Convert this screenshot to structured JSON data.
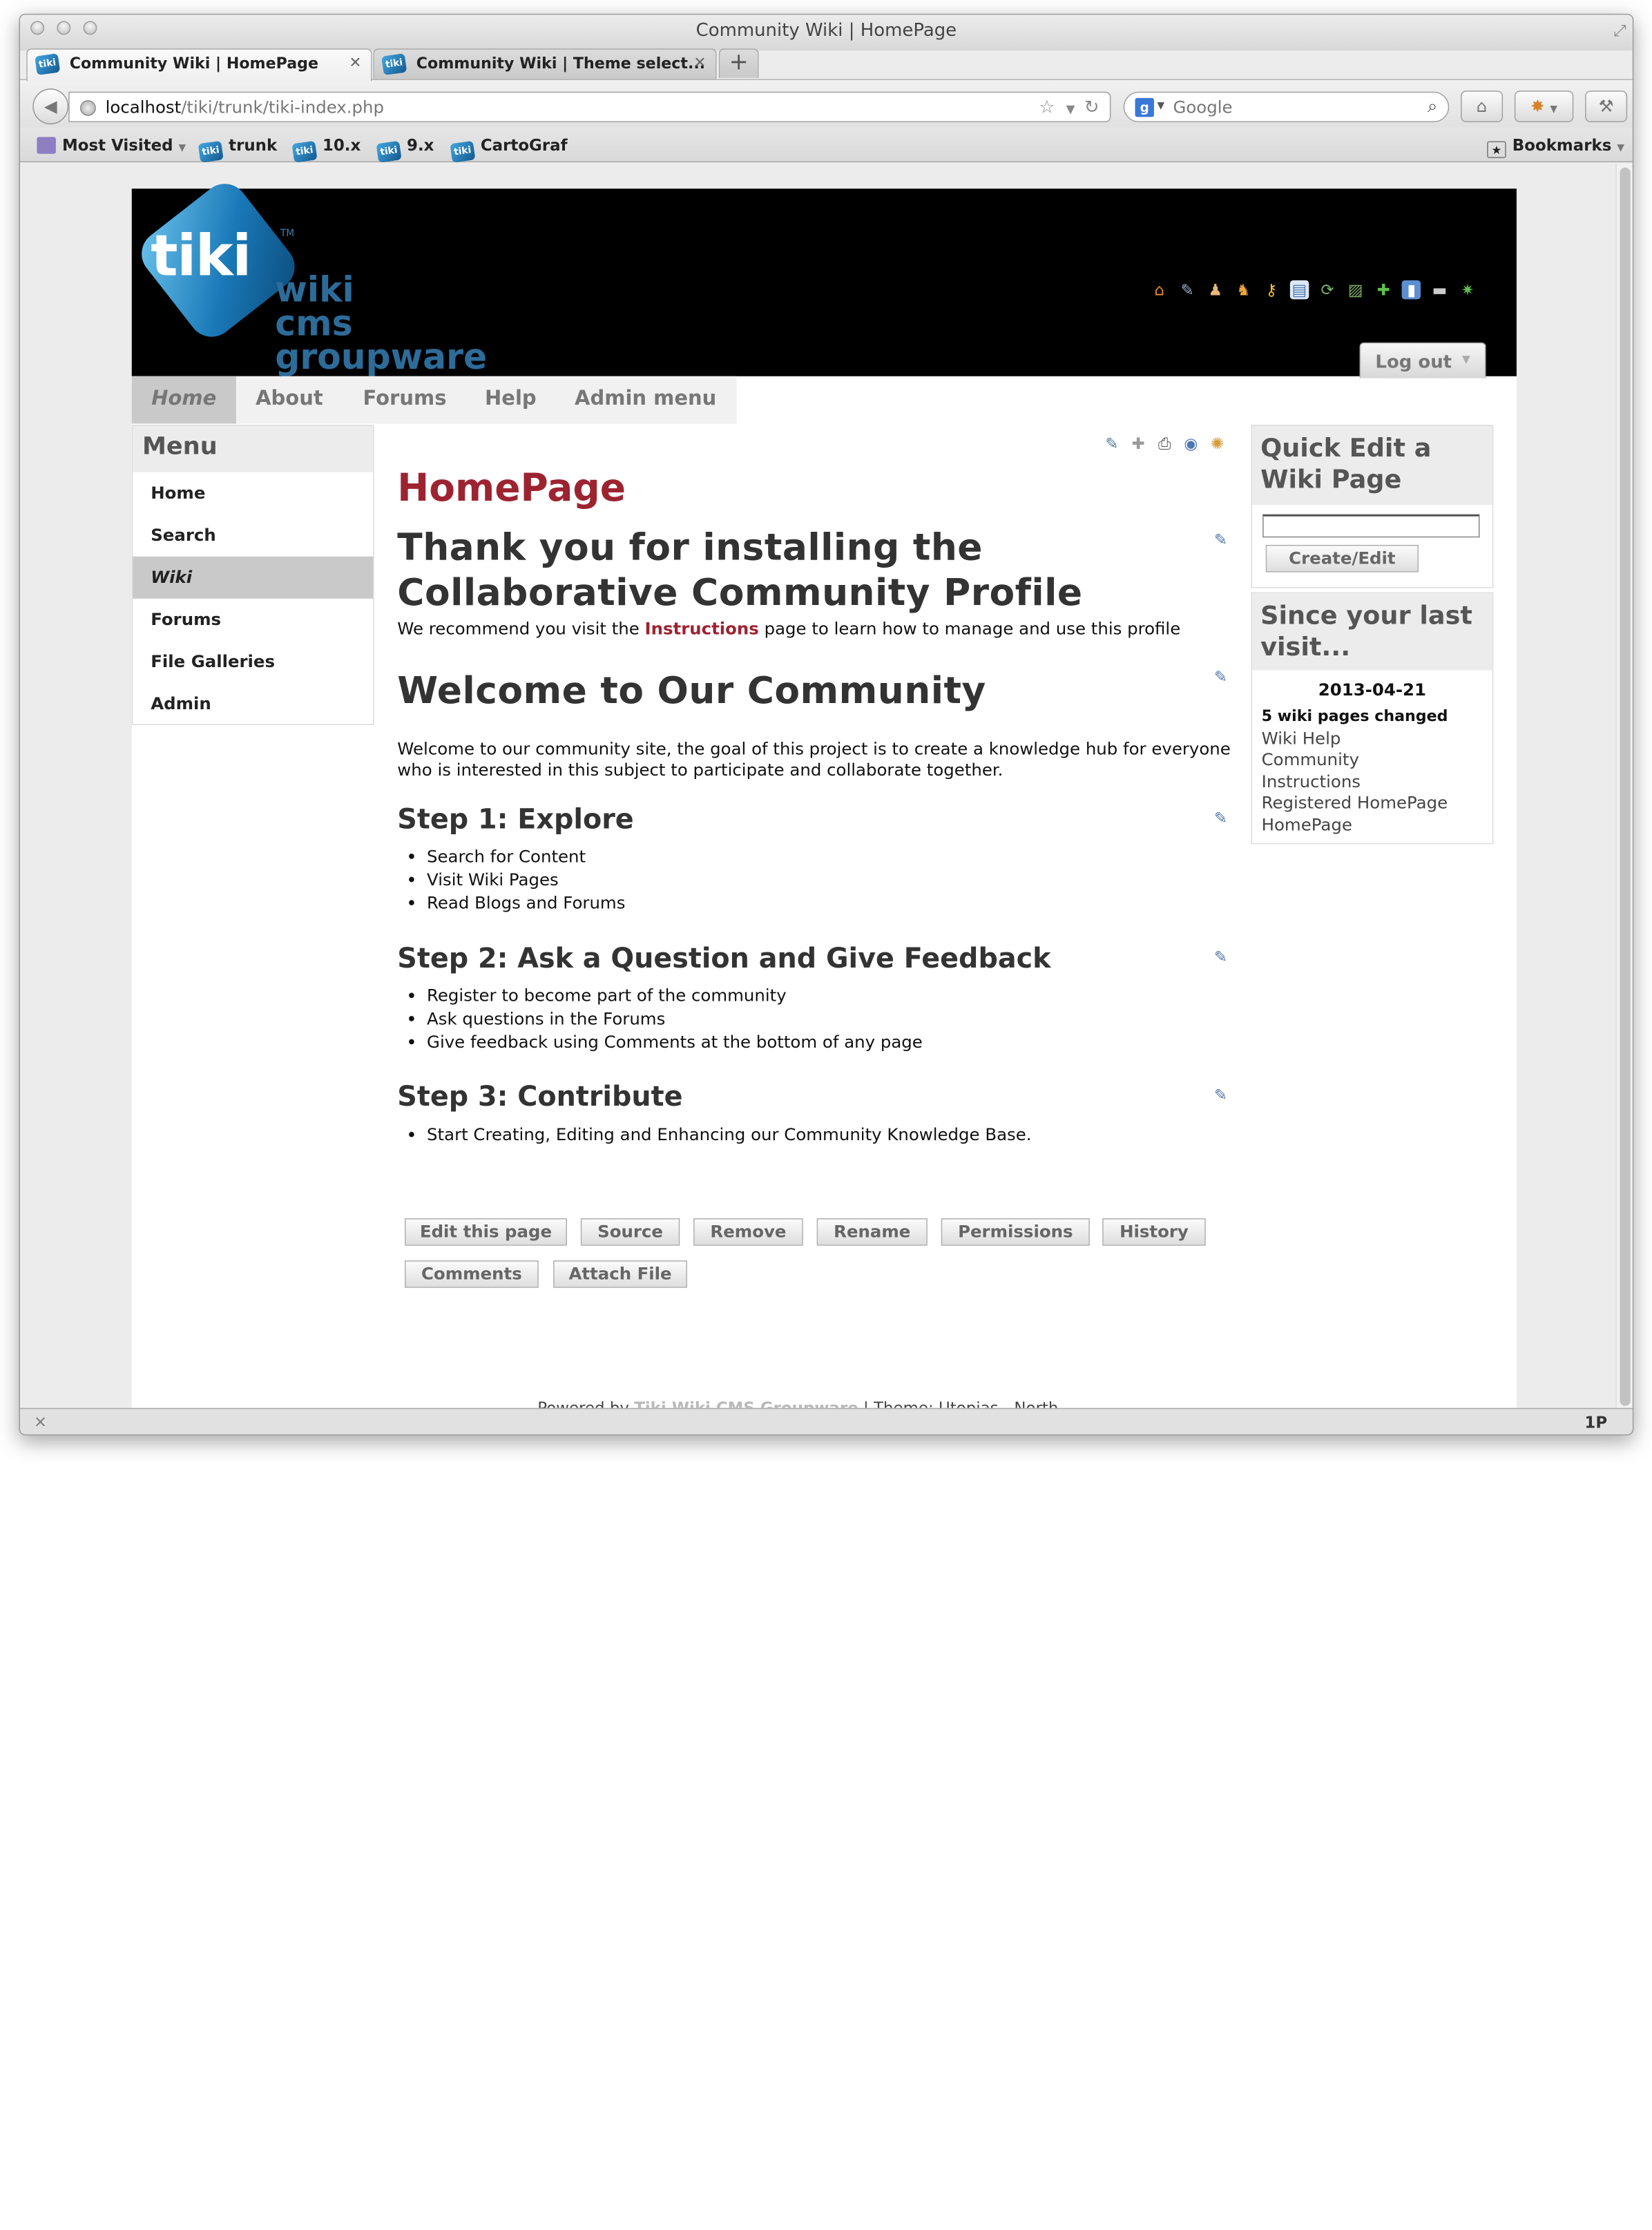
{
  "window": {
    "title": "Community Wiki | HomePage"
  },
  "tabs": [
    {
      "label": "Community Wiki | HomePage",
      "active": true
    },
    {
      "label": "Community Wiki | Theme select...",
      "active": false
    }
  ],
  "tab_favicon_text": "tiki",
  "new_tab_label": "+",
  "address": {
    "host": "localhost",
    "path": "/tiki/trunk/tiki-index.php"
  },
  "search": {
    "engine_icon": "g",
    "placeholder": "Google"
  },
  "bookmarks_bar": [
    {
      "label": "Most Visited",
      "icon": "most-visited-icon",
      "dropdown": true
    },
    {
      "label": "trunk",
      "icon": "tiki-favicon"
    },
    {
      "label": "10.x",
      "icon": "tiki-favicon"
    },
    {
      "label": "9.x",
      "icon": "tiki-favicon"
    },
    {
      "label": "CartoGraf",
      "icon": "tiki-favicon"
    }
  ],
  "bookmarks_menu": "Bookmarks",
  "site": {
    "logo": {
      "mark": "tiki",
      "trademark": "TM",
      "words": [
        "wiki",
        "cms",
        "groupware"
      ]
    },
    "logout": "Log out",
    "top_icons": [
      "home-icon",
      "wrench-icon",
      "user-icon",
      "users-icon",
      "key-icon",
      "panel-icon",
      "refresh-icon",
      "edit-page-icon",
      "plugin-icon",
      "file-icon",
      "minus-icon",
      "gear-icon"
    ],
    "nav": [
      "Home",
      "About",
      "Forums",
      "Help",
      "Admin menu"
    ],
    "nav_active": 0,
    "menu": {
      "title": "Menu",
      "items": [
        "Home",
        "Search",
        "Wiki",
        "Forums",
        "File Galleries",
        "Admin"
      ],
      "active": 2
    },
    "page_icons": [
      "edit-icon",
      "puzzle-icon",
      "print-icon",
      "watch-icon",
      "translate-icon"
    ],
    "page_title": "HomePage",
    "heading1_line1": "Thank you for installing the",
    "heading1_line2": "Collaborative Community Profile",
    "recommend": {
      "before": "We recommend you visit the ",
      "link": "Instructions",
      "after": " page to learn how to manage and use this profile"
    },
    "heading2": "Welcome to Our Community",
    "welcome_line1": "Welcome to our community site, the goal of this project is to create a knowledge hub for everyone",
    "welcome_line2": "who is interested in this subject to participate and collaborate together.",
    "steps": [
      {
        "title": "Step 1: Explore",
        "items": [
          "Search for Content",
          "Visit Wiki Pages",
          "Read Blogs and Forums"
        ]
      },
      {
        "title": "Step 2: Ask a Question and Give Feedback",
        "items": [
          "Register to become part of the community",
          "Ask questions in the Forums",
          "Give feedback using Comments at the bottom of any page"
        ]
      },
      {
        "title": "Step 3: Contribute",
        "items": [
          "Start Creating, Editing and Enhancing our Community Knowledge Base."
        ]
      }
    ],
    "actions": [
      "Edit this page",
      "Source",
      "Remove",
      "Rename",
      "Permissions",
      "History",
      "Comments",
      "Attach File"
    ],
    "footer": {
      "before": "Powered by ",
      "link": "Tiki Wiki CMS Groupware",
      "after": " | Theme: Utopias - North"
    },
    "quick_edit": {
      "title_line1": "Quick Edit a",
      "title_line2": "Wiki Page",
      "input_value": "",
      "button": "Create/Edit"
    },
    "since_last": {
      "title_line1": "Since your last",
      "title_line2": "visit...",
      "date": "2013-04-21",
      "summary": "5 wiki pages changed",
      "pages": [
        "Wiki Help",
        "Community",
        "Instructions",
        "Registered HomePage",
        "HomePage"
      ]
    }
  },
  "status_bar": {
    "close": "×",
    "badge": "1P"
  }
}
